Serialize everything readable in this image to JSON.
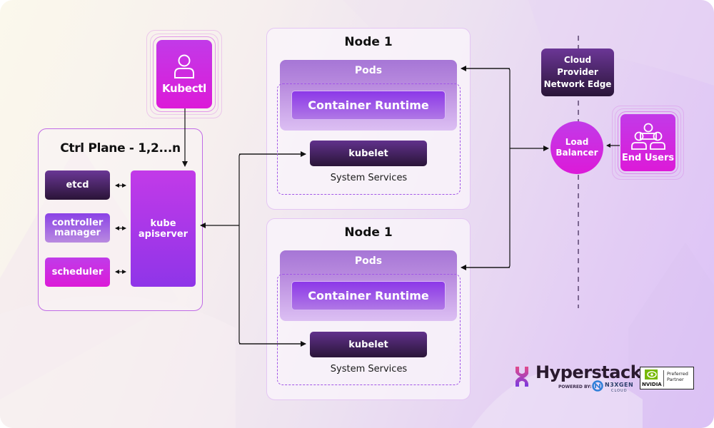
{
  "diagram": {
    "kubectl": {
      "label": "Kubectl",
      "icon": "user-icon"
    },
    "control_plane": {
      "title": "Ctrl Plane - 1,2...n",
      "components": [
        {
          "label_lines": [
            "etcd"
          ]
        },
        {
          "label_lines": [
            "controller",
            "manager"
          ]
        },
        {
          "label_lines": [
            "scheduler"
          ]
        }
      ],
      "apiserver": {
        "label_lines": [
          "kube",
          "apiserver"
        ]
      }
    },
    "nodes": [
      {
        "title": "Node 1",
        "pods_label": "Pods",
        "runtime_label": "Container Runtime",
        "kubelet_label": "kubelet",
        "services_label": "System Services"
      },
      {
        "title": "Node 1",
        "pods_label": "Pods",
        "runtime_label": "Container Runtime",
        "kubelet_label": "kubelet",
        "services_label": "System Services"
      }
    ],
    "network_edge": {
      "label_lines": [
        "Cloud",
        "Provider",
        "Network Edge"
      ]
    },
    "load_balancer": {
      "label_lines": [
        "Load",
        "Balancer"
      ]
    },
    "end_users": {
      "label": "End Users",
      "icon": "users-group-icon"
    }
  },
  "branding": {
    "hyperstack": {
      "name": "Hyperstack",
      "powered_by": "POWERED BY:",
      "partner_name": "N3XGEN",
      "partner_sub": "CLOUD"
    },
    "nvidia": {
      "name": "NVIDIA",
      "badge_lines": [
        "Preferred",
        "Partner"
      ]
    }
  },
  "colors": {
    "magenta": "#d624dd",
    "purple": "#9a3ae8",
    "dark_purple": "#2a1538",
    "border": "#c06ae6"
  }
}
